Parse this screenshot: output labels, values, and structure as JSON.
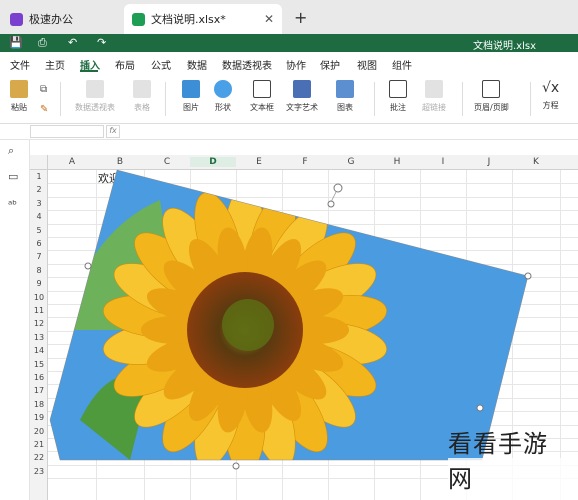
{
  "tabs": [
    {
      "label": "极速办公",
      "color": "#7b3fd0"
    },
    {
      "label": "文档说明.xlsx*",
      "color": "#1e9d55"
    }
  ],
  "quickbar": {
    "title": "文档说明.xlsx",
    "icons": [
      "save-icon",
      "print-icon",
      "undo-icon",
      "redo-icon"
    ]
  },
  "menu": [
    "文件",
    "主页",
    "插入",
    "布局",
    "公式",
    "数据",
    "数据透视表",
    "协作",
    "保护",
    "视图",
    "组件"
  ],
  "active_menu": "插入",
  "ribbon": {
    "paste": "粘贴",
    "pivot": "数据透视表",
    "table": "表格",
    "picture": "图片",
    "shape": "形状",
    "textbox": "文本框",
    "wordart": "文字艺术",
    "chart": "图表",
    "comment": "批注",
    "hyperlink": "超链接",
    "headerfooter": "页眉/页脚",
    "equation": "方程"
  },
  "formula": {
    "fx": "fx"
  },
  "columns": [
    "A",
    "B",
    "C",
    "D",
    "E",
    "F",
    "G",
    "H",
    "I",
    "J",
    "K"
  ],
  "selected_column": "D",
  "rows": [
    "1",
    "2",
    "3",
    "4",
    "5",
    "6",
    "7",
    "8",
    "9",
    "10",
    "11",
    "12",
    "13",
    "14",
    "15",
    "16",
    "17",
    "18",
    "19",
    "20",
    "21",
    "22",
    "23"
  ],
  "cell_b1": "欢迎",
  "watermark": "看看手游网",
  "colors": {
    "accent": "#1e6b41",
    "sky": "#4a9be0",
    "petal": "#f3b51c"
  }
}
